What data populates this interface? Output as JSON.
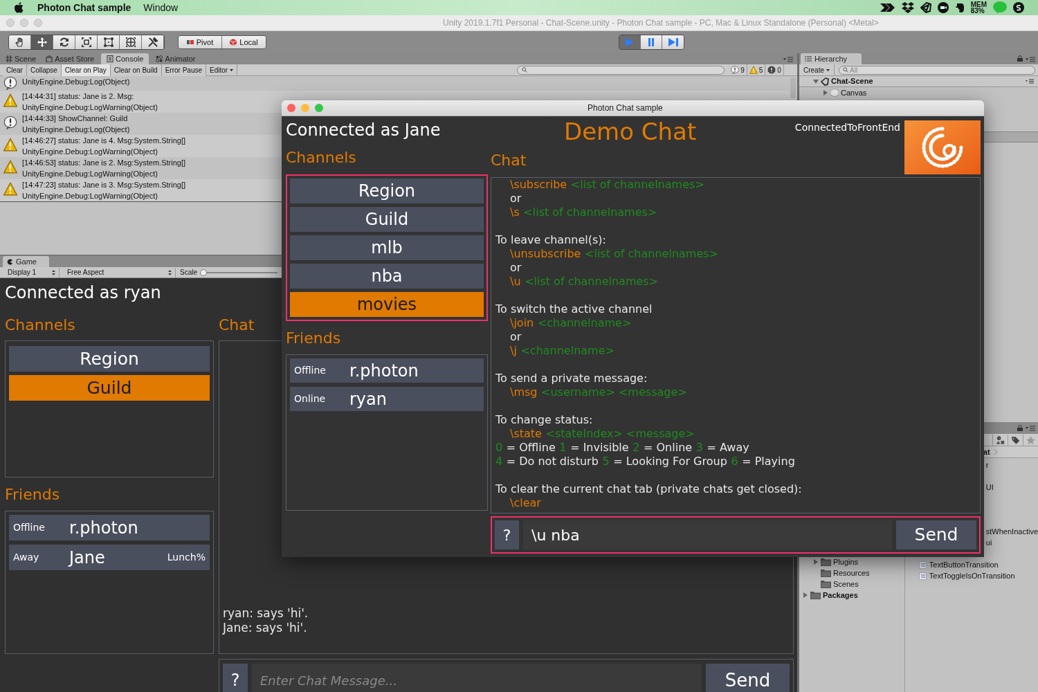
{
  "menu_bar": {
    "app": "Photon Chat sample",
    "items": [
      "Window"
    ],
    "mem_label": "MEM",
    "mem_value": "83%"
  },
  "editor": {
    "title": "Unity 2019.1.7f1 Personal - Chat-Scene.unity - Photon Chat sample - PC, Mac & Linux Standalone (Personal) <Metal>",
    "tools": [
      {
        "kind": "hand",
        "selected": false
      },
      {
        "kind": "move",
        "selected": true
      },
      {
        "kind": "rotate",
        "selected": false
      },
      {
        "kind": "scale",
        "selected": false
      },
      {
        "kind": "rect",
        "selected": false
      },
      {
        "kind": "transform",
        "selected": false
      },
      {
        "kind": "custom",
        "selected": false
      }
    ],
    "pivot": "Pivot",
    "local": "Local",
    "playing": true
  },
  "console": {
    "tabs": [
      {
        "label": "Scene",
        "kind": "scene",
        "selected": false
      },
      {
        "label": "Asset Store",
        "kind": "store",
        "selected": false
      },
      {
        "label": "Console",
        "kind": "console",
        "selected": true
      },
      {
        "label": "Animator",
        "kind": "animator",
        "selected": false
      }
    ],
    "toolbar": [
      {
        "label": "Clear",
        "on": false
      },
      {
        "label": "Collapse",
        "on": false
      },
      {
        "label": "Clear on Play",
        "on": true
      },
      {
        "label": "Clear on Build",
        "on": false
      },
      {
        "label": "Error Pause",
        "on": false
      }
    ],
    "editor_dropdown": "Editor",
    "counts": [
      {
        "kind": "info",
        "count": "9"
      },
      {
        "kind": "warning",
        "count": "5"
      },
      {
        "kind": "error",
        "count": "0"
      }
    ],
    "entries": [
      {
        "kind": "info",
        "lines": [
          "UnityEngine.Debug:Log(Object)"
        ]
      },
      {
        "kind": "warning",
        "lines": [
          "[14:44:31] status: Jane is 2. Msg:",
          "UnityEngine.Debug:LogWarning(Object)"
        ]
      },
      {
        "kind": "info",
        "lines": [
          "[14:44:33] ShowChannel: Guild",
          "UnityEngine.Debug:Log(Object)"
        ]
      },
      {
        "kind": "warning",
        "lines": [
          "[14:46:27] status: Jane is 4. Msg:System.String[]",
          "UnityEngine.Debug:LogWarning(Object)"
        ]
      },
      {
        "kind": "warning",
        "lines": [
          "[14:46:53] status: Jane is 2. Msg:System.String[]",
          "UnityEngine.Debug:LogWarning(Object)"
        ]
      },
      {
        "kind": "warning",
        "lines": [
          "[14:47:23] status: Jane is 3. Msg:System.String[]",
          "UnityEngine.Debug:LogWarning(Object)"
        ]
      }
    ]
  },
  "hierarchy": {
    "tab": "Hierarchy",
    "create": "Create",
    "search_placeholder": "All",
    "tree": [
      {
        "label": "Chat-Scene",
        "expanded": true,
        "children": [
          {
            "label": "Canvas",
            "expanded": false
          }
        ]
      }
    ]
  },
  "project": {
    "folders": [
      {
        "label": "Plugins",
        "has_children": true
      },
      {
        "label": "Resources",
        "has_children": false
      },
      {
        "label": "Scenes",
        "has_children": false
      }
    ],
    "packages": {
      "label": "Packages",
      "expanded": false
    },
    "breadcrumb": "at",
    "items": [
      {
        "kind": "partial",
        "label": "r"
      },
      {
        "kind": "partial",
        "label": "UI"
      },
      {
        "kind": "partial",
        "label": "stWhenInactive"
      },
      {
        "kind": "partial",
        "label": "ui"
      },
      {
        "kind": "script",
        "label": "TextButtonTransition"
      },
      {
        "kind": "script",
        "label": "TextToggleIsOnTransition"
      }
    ]
  },
  "game": {
    "tab": "Game",
    "display": "Display 1",
    "aspect": "Free Aspect",
    "scale": {
      "label": "Scale",
      "level": 0
    },
    "ui": {
      "connected_as": "Connected as ryan",
      "channels_label": "Channels",
      "chat_label": "Chat",
      "friends_label": "Friends",
      "channels_highlighted": false,
      "input_highlighted": false,
      "channels": [
        {
          "label": "Region",
          "selected": false
        },
        {
          "label": "Guild",
          "selected": true
        }
      ],
      "friends": [
        {
          "status": "Offline",
          "name": "r.photon"
        },
        {
          "status": "Away",
          "name": "Jane",
          "message": "Lunch%"
        }
      ],
      "chat_blocks": [
        {
          "lines": [
            {
              "kind": "text",
              "parts": [
                {
                  "kind": "plain",
                  "text": "ryan: says 'hi'."
                }
              ]
            },
            {
              "kind": "text",
              "parts": [
                {
                  "kind": "plain",
                  "text": "Jane: says 'hi'."
                }
              ]
            }
          ]
        }
      ],
      "input": {
        "help": "?",
        "placeholder": "Enter Chat Message...",
        "send": "Send"
      }
    }
  },
  "chat_window": {
    "title": "Photon Chat sample",
    "ui": {
      "connected_as": "Connected as Jane",
      "heading": "Demo Chat",
      "state": "ConnectedToFrontEnd",
      "channels_label": "Channels",
      "chat_label": "Chat",
      "friends_label": "Friends",
      "channels_highlighted": true,
      "input_highlighted": true,
      "channels": [
        {
          "label": "Region",
          "selected": false
        },
        {
          "label": "Guild",
          "selected": false
        },
        {
          "label": "mlb",
          "selected": false
        },
        {
          "label": "nba",
          "selected": false
        },
        {
          "label": "movies",
          "selected": true
        }
      ],
      "friends": [
        {
          "status": "Offline",
          "name": "r.photon"
        },
        {
          "status": "Online",
          "name": "ryan"
        }
      ],
      "chat_blocks": [
        {
          "lines": [
            {
              "kind": "usage",
              "parts": [
                {
                  "kind": "command",
                  "text": "\\subscribe"
                },
                {
                  "kind": "param",
                  "text": "<list of channelnames>"
                }
              ]
            },
            {
              "kind": "usage",
              "parts": [
                {
                  "kind": "plain",
                  "text": "or"
                }
              ]
            },
            {
              "kind": "usage",
              "parts": [
                {
                  "kind": "command",
                  "text": "\\s"
                },
                {
                  "kind": "param",
                  "text": "<list of channelnames>"
                }
              ]
            }
          ]
        },
        {
          "lines": [
            {
              "kind": "text",
              "parts": [
                {
                  "kind": "plain",
                  "text": "To leave channel(s):"
                }
              ]
            },
            {
              "kind": "usage",
              "parts": [
                {
                  "kind": "command",
                  "text": "\\unsubscribe"
                },
                {
                  "kind": "param",
                  "text": "<list of channelnames>"
                }
              ]
            },
            {
              "kind": "usage",
              "parts": [
                {
                  "kind": "plain",
                  "text": "or"
                }
              ]
            },
            {
              "kind": "usage",
              "parts": [
                {
                  "kind": "command",
                  "text": "\\u"
                },
                {
                  "kind": "param",
                  "text": "<list of channelnames>"
                }
              ]
            }
          ]
        },
        {
          "lines": [
            {
              "kind": "text",
              "parts": [
                {
                  "kind": "plain",
                  "text": "To switch the active channel"
                }
              ]
            },
            {
              "kind": "usage",
              "parts": [
                {
                  "kind": "command",
                  "text": "\\join"
                },
                {
                  "kind": "param",
                  "text": "<channelname>"
                }
              ]
            },
            {
              "kind": "usage",
              "parts": [
                {
                  "kind": "plain",
                  "text": "or"
                }
              ]
            },
            {
              "kind": "usage",
              "parts": [
                {
                  "kind": "command",
                  "text": "\\j"
                },
                {
                  "kind": "param",
                  "text": "<channelname>"
                }
              ]
            }
          ]
        },
        {
          "lines": [
            {
              "kind": "text",
              "parts": [
                {
                  "kind": "plain",
                  "text": "To send a private message:"
                }
              ]
            },
            {
              "kind": "usage",
              "parts": [
                {
                  "kind": "command",
                  "text": "\\msg"
                },
                {
                  "kind": "param",
                  "text": "<username> <message>"
                }
              ]
            }
          ]
        },
        {
          "lines": [
            {
              "kind": "text",
              "parts": [
                {
                  "kind": "plain",
                  "text": "To change status:"
                }
              ]
            },
            {
              "kind": "usage",
              "parts": [
                {
                  "kind": "command",
                  "text": "\\state"
                },
                {
                  "kind": "param",
                  "text": "<stateIndex> <message>"
                }
              ]
            },
            {
              "kind": "text",
              "parts": [
                {
                  "kind": "param",
                  "text": "0"
                },
                {
                  "kind": "plain",
                  "text": "= Offline"
                },
                {
                  "kind": "param",
                  "text": "1"
                },
                {
                  "kind": "plain",
                  "text": "= Invisible"
                },
                {
                  "kind": "param",
                  "text": "2"
                },
                {
                  "kind": "plain",
                  "text": "= Online"
                },
                {
                  "kind": "param",
                  "text": "3"
                },
                {
                  "kind": "plain",
                  "text": "= Away"
                }
              ]
            },
            {
              "kind": "text",
              "parts": [
                {
                  "kind": "param",
                  "text": "4"
                },
                {
                  "kind": "plain",
                  "text": "= Do not disturb"
                },
                {
                  "kind": "param",
                  "text": "5"
                },
                {
                  "kind": "plain",
                  "text": "= Looking For Group"
                },
                {
                  "kind": "param",
                  "text": "6"
                },
                {
                  "kind": "plain",
                  "text": "= Playing"
                }
              ]
            }
          ]
        },
        {
          "lines": [
            {
              "kind": "text",
              "parts": [
                {
                  "kind": "plain",
                  "text": "To clear the current chat tab (private chats get closed):"
                }
              ]
            },
            {
              "kind": "usage",
              "parts": [
                {
                  "kind": "command",
                  "text": "\\clear"
                }
              ]
            }
          ]
        }
      ],
      "input": {
        "help": "?",
        "value": "\\u nba",
        "send": "Send"
      }
    }
  }
}
